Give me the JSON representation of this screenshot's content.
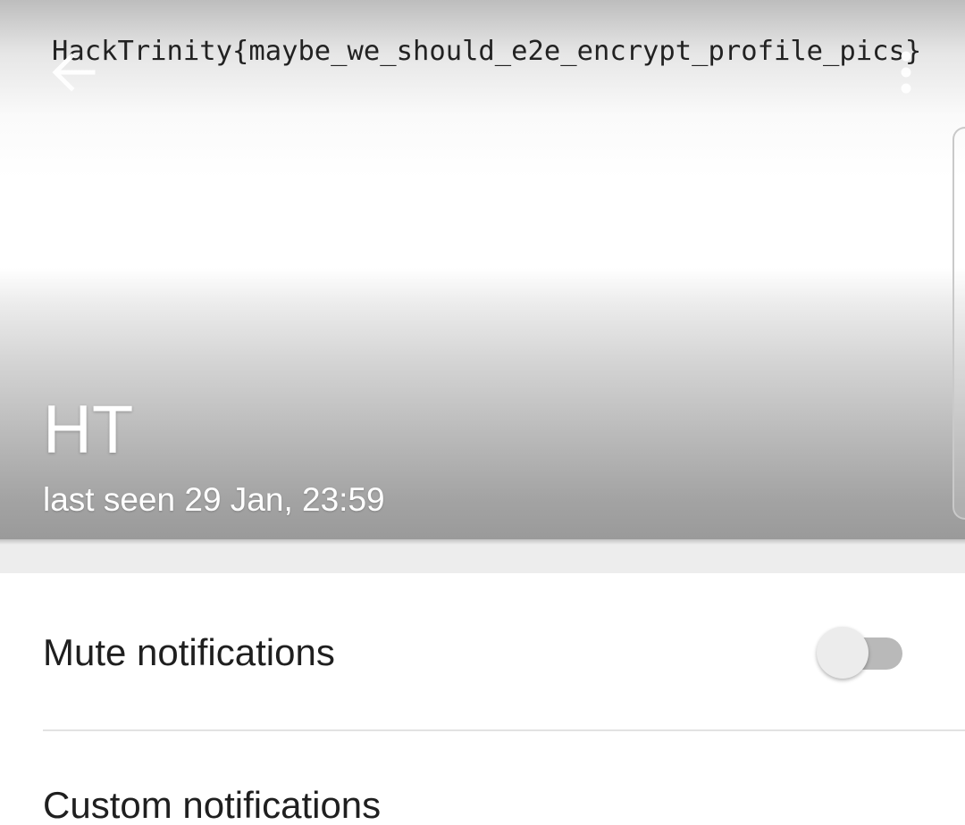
{
  "header": {
    "photo_text": "HackTrinity{maybe_we_should_e2e_encrypt_profile_pics}",
    "back_icon": "arrow-left-icon",
    "menu_icon": "more-vertical-icon",
    "contact_name": "HT",
    "last_seen": "last seen 29 Jan, 23:59"
  },
  "settings": {
    "mute": {
      "label": "Mute notifications",
      "enabled": false
    },
    "custom": {
      "label": "Custom notifications"
    }
  },
  "colors": {
    "toggle_track_off": "#b9b9b9",
    "toggle_thumb_off": "#ececec",
    "band": "#ededed"
  }
}
